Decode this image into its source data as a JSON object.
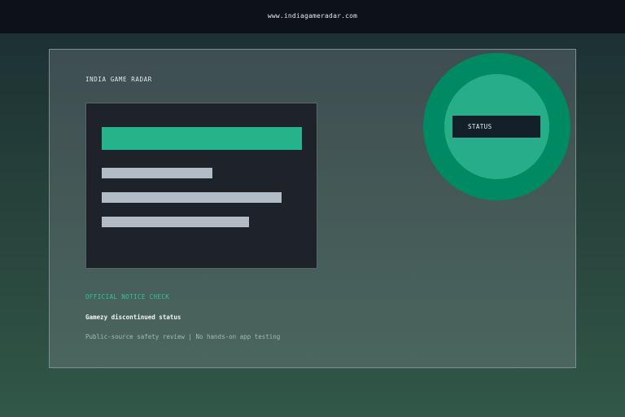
{
  "header": {
    "site_url": "www.indiagameradar.com"
  },
  "card": {
    "brand": "INDIA GAME RADAR",
    "notice_label": "OFFICIAL NOTICE CHECK",
    "headline": "Gamezy discontinued status",
    "meta": "Public-source safety review | No hands-on app testing"
  },
  "badge": {
    "label": "STATUS"
  },
  "colors": {
    "accent": "#25b389",
    "badge_outer": "#008a63",
    "badge_inner": "#27ae88",
    "notice_text": "#2ec792"
  }
}
